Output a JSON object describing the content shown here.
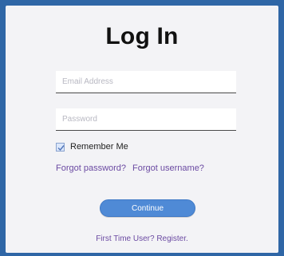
{
  "title": "Log In",
  "form": {
    "email": {
      "placeholder": "Email Address",
      "value": ""
    },
    "password": {
      "placeholder": "Password",
      "value": ""
    },
    "remember_me": {
      "label": "Remember Me",
      "checked": true
    },
    "forgot_password": "Forgot password?",
    "forgot_username": "Forgot username?",
    "continue_label": "Continue",
    "register_link": "First Time User? Register."
  },
  "colors": {
    "frame": "#2f66a6",
    "card": "#f3f3f6",
    "button": "#4f8ad6",
    "link": "#6b4aa2"
  }
}
